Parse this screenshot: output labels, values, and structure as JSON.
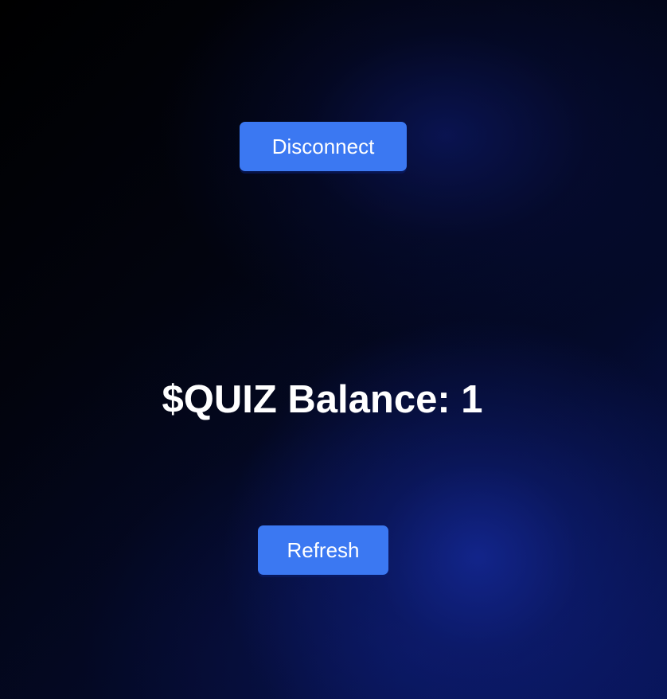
{
  "header": {
    "disconnect_label": "Disconnect"
  },
  "balance": {
    "label": "$QUIZ Balance: 1"
  },
  "actions": {
    "refresh_label": "Refresh"
  },
  "colors": {
    "button_bg": "#3b78f2",
    "button_text": "#ffffff",
    "background_dark": "#02030a",
    "background_glow": "#142896"
  }
}
